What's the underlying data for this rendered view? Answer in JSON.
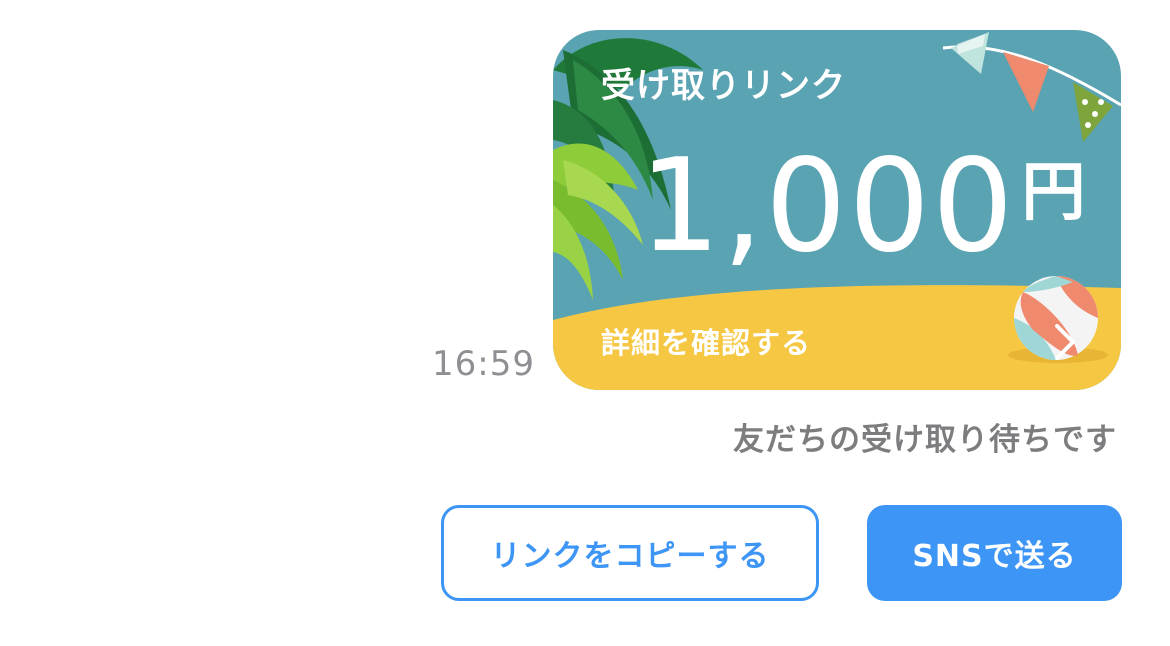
{
  "message": {
    "timestamp": "16:59",
    "card": {
      "title": "受け取りリンク",
      "amount": "1,000",
      "currency": "円",
      "details_label": "詳細を確認する",
      "background_color": "#5aa3b2",
      "sand_color": "#f6c743",
      "icons": [
        "palm-leaves-icon",
        "bunting-flags-icon",
        "beach-ball-icon",
        "chevron-right-icon"
      ]
    },
    "status": "友だちの受け取り待ちです"
  },
  "actions": {
    "copy_link_label": "リンクをコピーする",
    "sns_label": "SNSで送る",
    "accent_color": "#3d95f5"
  }
}
